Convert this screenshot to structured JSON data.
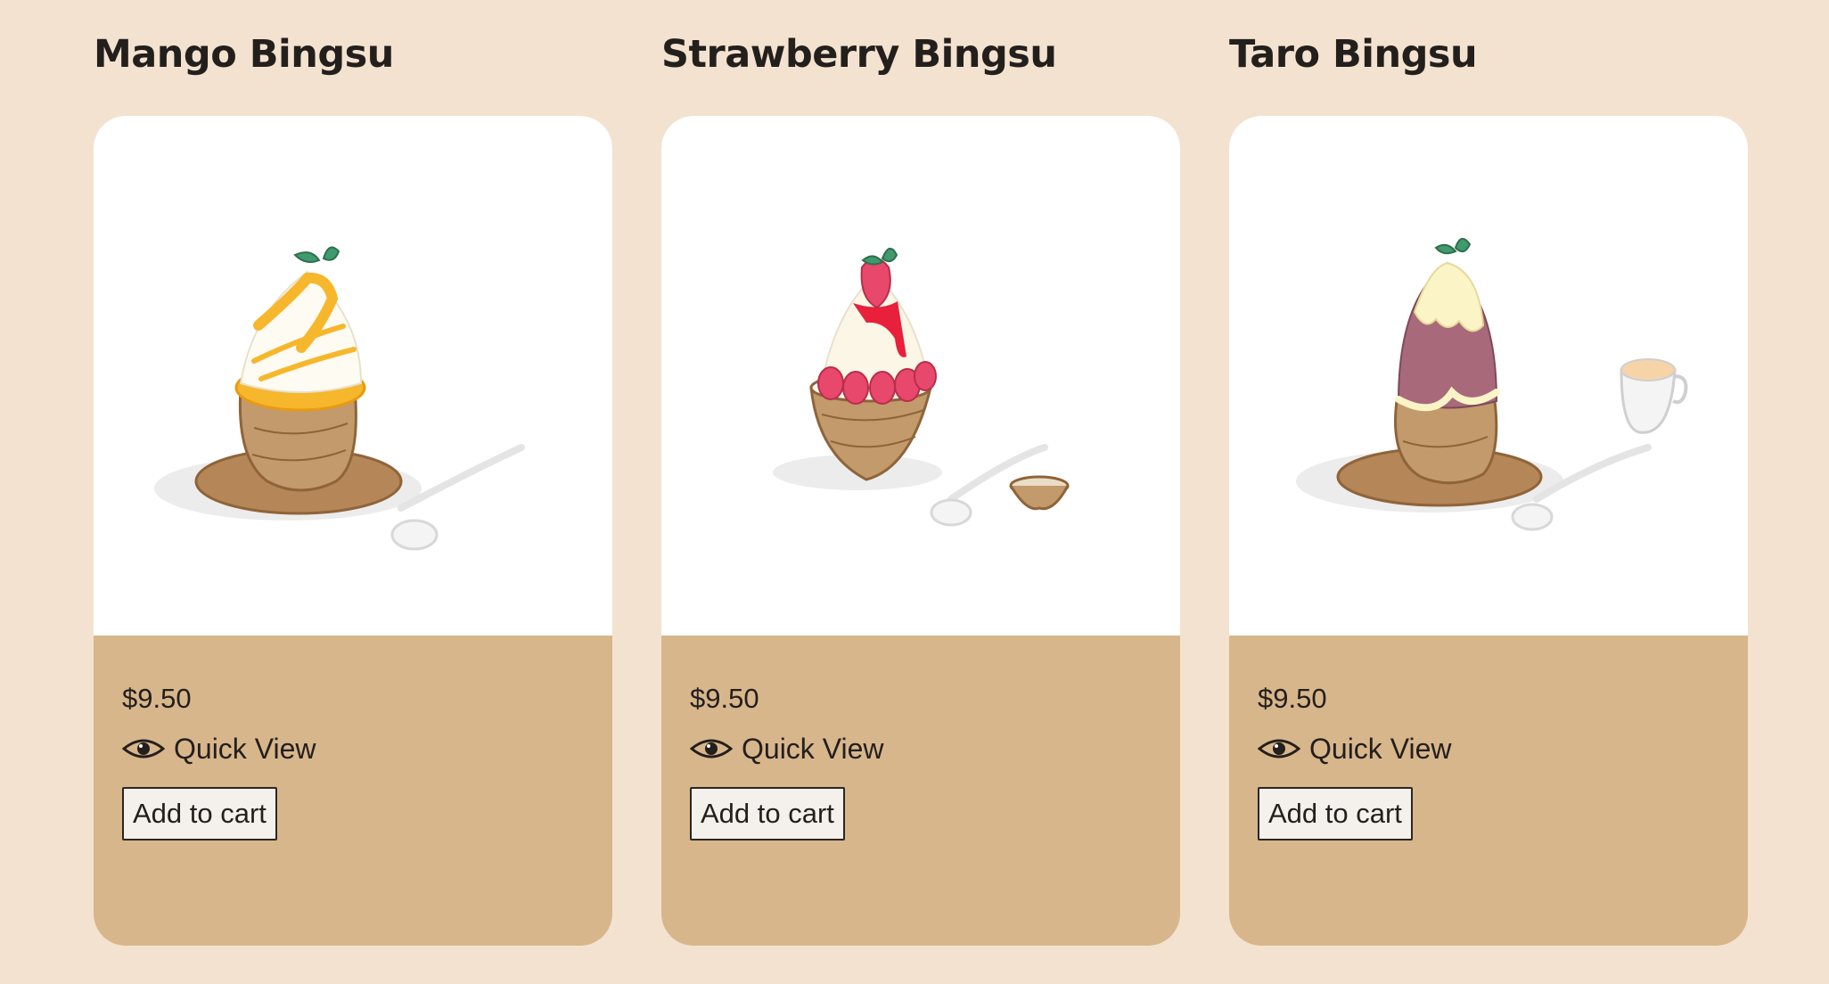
{
  "products": [
    {
      "title": "Mango Bingsu",
      "price": "$9.50",
      "quick_view_label": "Quick View",
      "add_to_cart_label": "Add to cart",
      "image_icon": "mango-bingsu-illustration"
    },
    {
      "title": "Strawberry Bingsu",
      "price": "$9.50",
      "quick_view_label": "Quick View",
      "add_to_cart_label": "Add to cart",
      "image_icon": "strawberry-bingsu-illustration"
    },
    {
      "title": "Taro Bingsu",
      "price": "$9.50",
      "quick_view_label": "Quick View",
      "add_to_cart_label": "Add to cart",
      "image_icon": "taro-bingsu-illustration"
    }
  ],
  "colors": {
    "page_background": "#f3e2cf",
    "card_footer": "#d8b68c",
    "card_image_background": "#ffffff",
    "text": "#231f1c",
    "button_background": "#f4f1ec"
  }
}
